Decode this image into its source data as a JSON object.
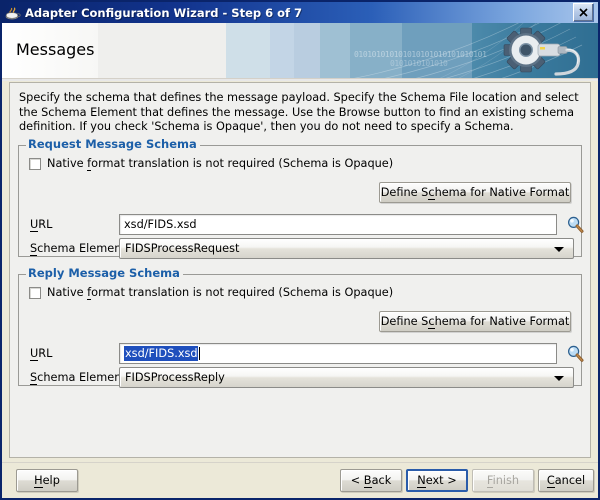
{
  "window": {
    "title": "Adapter Configuration Wizard - Step 6 of 7",
    "app_icon": "java-coffee-cup-icon",
    "close_label": "✕"
  },
  "header": {
    "page_title": "Messages",
    "banner_binary_line1": "010101010101010101010101010101",
    "banner_binary_line2": "0101010101010",
    "banner_graphic": "gear-and-plug-icon"
  },
  "content": {
    "instructions": "Specify the schema that defines the message payload.  Specify the Schema File location and select the Schema Element that defines the message. Use the Browse button to find an existing schema definition. If you check 'Schema is Opaque', then you do not need to specify a Schema."
  },
  "request_group": {
    "title": "Request Message Schema",
    "opaque_checkbox": {
      "label_before": "Native ",
      "label_mnemonic": "f",
      "label_after": "ormat translation is not required (Schema is Opaque)",
      "checked": false
    },
    "define_button": {
      "label_before": "Define S",
      "label_mnemonic": "c",
      "label_after": "hema for Native Format"
    },
    "url_label_mnemonic": "U",
    "url_label_after": "RL",
    "url_value": "xsd/FIDS.xsd",
    "browse_icon": "magnifier-icon",
    "schema_element_label_mnemonic": "S",
    "schema_element_label_after": "chema Element",
    "schema_element_value": "FIDSProcessRequest"
  },
  "reply_group": {
    "title": "Reply Message Schema",
    "opaque_checkbox": {
      "label_before": "Native ",
      "label_mnemonic": "f",
      "label_after": "ormat translation is not required (Schema is Opaque)",
      "checked": false
    },
    "define_button": {
      "label_before": "Define S",
      "label_mnemonic": "c",
      "label_after": "hema for Native Format"
    },
    "url_label_mnemonic": "U",
    "url_label_after": "RL",
    "url_value": "xsd/FIDS.xsd",
    "url_selected": true,
    "browse_icon": "magnifier-icon",
    "schema_element_label_mnemonic": "S",
    "schema_element_label_after": "chema Element",
    "schema_element_value": "FIDSProcessReply"
  },
  "footer": {
    "help": {
      "before": "",
      "mnemonic": "H",
      "after": "elp"
    },
    "back": {
      "before": "< ",
      "mnemonic": "B",
      "after": "ack"
    },
    "next": {
      "before": "",
      "mnemonic": "N",
      "after": "ext >",
      "focused": true
    },
    "finish": {
      "before": "",
      "mnemonic": "F",
      "after": "inish",
      "disabled": true
    },
    "cancel": {
      "before": "",
      "mnemonic": "C",
      "after": "ancel"
    }
  },
  "colors": {
    "title_bar_start": "#0a246a",
    "group_title": "#1c5fa8",
    "selection": "#1f4fbd",
    "focus_border": "#2a5caa",
    "dialog_face": "#ece9d8",
    "panel_face": "#f0f0ee"
  }
}
